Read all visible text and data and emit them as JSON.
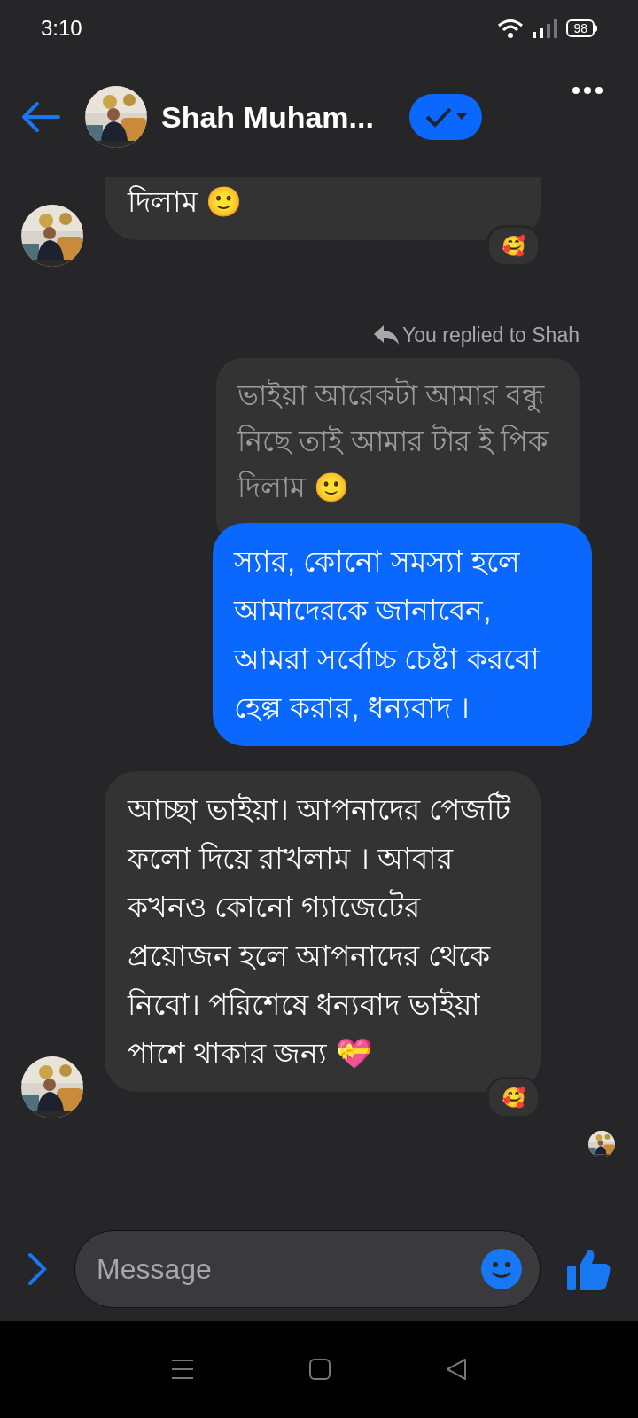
{
  "status_bar": {
    "time": "3:10",
    "battery": "98"
  },
  "header": {
    "name": "Shah Muham...",
    "verified": true
  },
  "messages": [
    {
      "kind": "received",
      "text": "দিলাম 🙂",
      "avatar": true,
      "reaction": "🥰",
      "cut_top": true
    },
    {
      "kind": "reply_quote",
      "label": "You replied to Shah",
      "text": "ভাইয়া আরেকটা আমার বন্ধু নিছে তাই আমার টার ই পিক দিলাম 🙂"
    },
    {
      "kind": "sent",
      "text": "স্যার, কোনো সমস্যা হলে আমাদেরকে জানাবেন, আমরা সর্বোচ্চ চেষ্টা করবো হেল্প করার, ধন্যবাদ ।"
    },
    {
      "kind": "received",
      "text": "আচ্ছা ভাইয়া। আপনাদের পেজটি ফলো দিয়ে রাখলাম । আবার কখনও কোনো গ্যাজেটের প্রয়োজন হলে আপনাদের থেকে নিবো। পরিশেষে ধন্যবাদ ভাইয়া পাশে থাকার জন্য  💝",
      "avatar": true,
      "reaction": "🥰",
      "cut_top": false
    }
  ],
  "composer": {
    "placeholder": "Message"
  }
}
